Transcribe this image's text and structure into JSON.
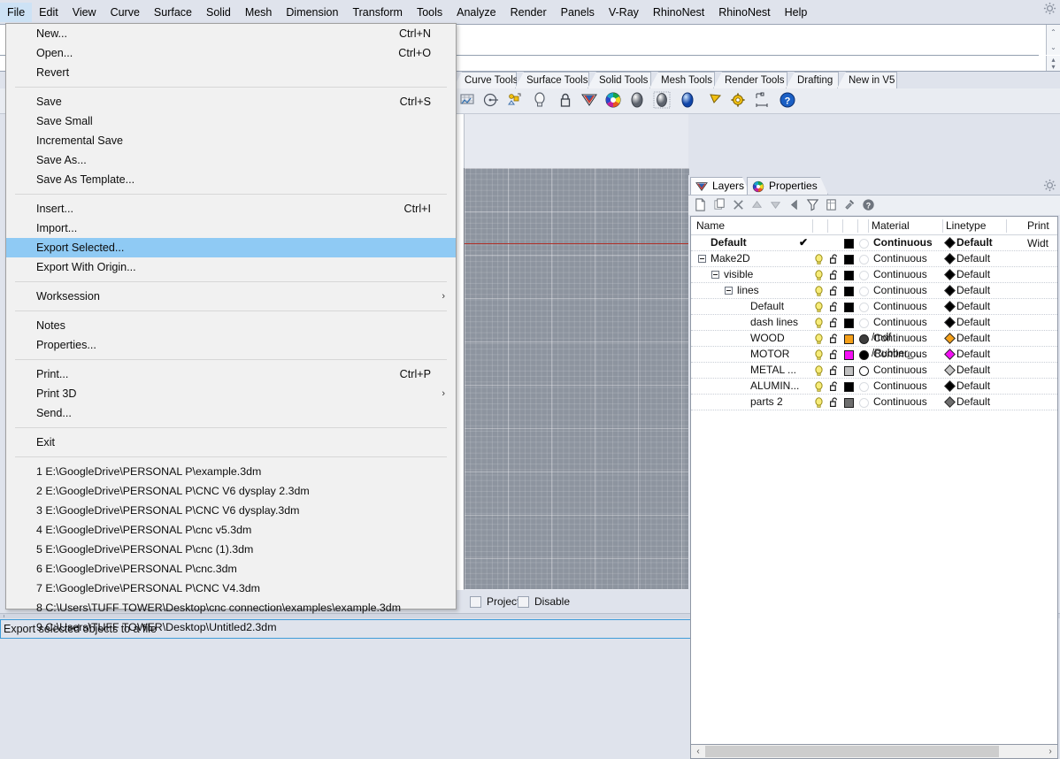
{
  "menubar": {
    "items": [
      {
        "label": "File",
        "active": true
      },
      {
        "label": "Edit",
        "active": false
      },
      {
        "label": "View",
        "active": false
      },
      {
        "label": "Curve",
        "active": false
      },
      {
        "label": "Surface",
        "active": false
      },
      {
        "label": "Solid",
        "active": false
      },
      {
        "label": "Mesh",
        "active": false
      },
      {
        "label": "Dimension",
        "active": false
      },
      {
        "label": "Transform",
        "active": false
      },
      {
        "label": "Tools",
        "active": false
      },
      {
        "label": "Analyze",
        "active": false
      },
      {
        "label": "Render",
        "active": false
      },
      {
        "label": "Panels",
        "active": false
      },
      {
        "label": "V-Ray",
        "active": false
      },
      {
        "label": "RhinoNest",
        "active": false
      },
      {
        "label": "RhinoNest",
        "active": false
      },
      {
        "label": "Help",
        "active": false
      }
    ]
  },
  "file_menu": {
    "groups": [
      {
        "items": [
          {
            "label": "New...",
            "shortcut": "Ctrl+N",
            "submenu": false,
            "highlight": false
          },
          {
            "label": "Open...",
            "shortcut": "Ctrl+O",
            "submenu": false,
            "highlight": false
          },
          {
            "label": "Revert",
            "shortcut": "",
            "submenu": false,
            "highlight": false
          }
        ]
      },
      {
        "items": [
          {
            "label": "Save",
            "shortcut": "Ctrl+S",
            "submenu": false,
            "highlight": false
          },
          {
            "label": "Save Small",
            "shortcut": "",
            "submenu": false,
            "highlight": false
          },
          {
            "label": "Incremental Save",
            "shortcut": "",
            "submenu": false,
            "highlight": false
          },
          {
            "label": "Save As...",
            "shortcut": "",
            "submenu": false,
            "highlight": false
          },
          {
            "label": "Save As Template...",
            "shortcut": "",
            "submenu": false,
            "highlight": false
          }
        ]
      },
      {
        "items": [
          {
            "label": "Insert...",
            "shortcut": "Ctrl+I",
            "submenu": false,
            "highlight": false
          },
          {
            "label": "Import...",
            "shortcut": "",
            "submenu": false,
            "highlight": false
          },
          {
            "label": "Export Selected...",
            "shortcut": "",
            "submenu": false,
            "highlight": true
          },
          {
            "label": "Export With Origin...",
            "shortcut": "",
            "submenu": false,
            "highlight": false
          }
        ]
      },
      {
        "items": [
          {
            "label": "Worksession",
            "shortcut": "",
            "submenu": true,
            "highlight": false
          }
        ]
      },
      {
        "items": [
          {
            "label": "Notes",
            "shortcut": "",
            "submenu": false,
            "highlight": false
          },
          {
            "label": "Properties...",
            "shortcut": "",
            "submenu": false,
            "highlight": false
          }
        ]
      },
      {
        "items": [
          {
            "label": "Print...",
            "shortcut": "Ctrl+P",
            "submenu": false,
            "highlight": false
          },
          {
            "label": "Print 3D",
            "shortcut": "",
            "submenu": true,
            "highlight": false
          },
          {
            "label": "Send...",
            "shortcut": "",
            "submenu": false,
            "highlight": false
          }
        ]
      },
      {
        "items": [
          {
            "label": "Exit",
            "shortcut": "",
            "submenu": false,
            "highlight": false
          }
        ]
      }
    ],
    "recent_files": [
      "1 E:\\GoogleDrive\\PERSONAL P\\example.3dm",
      "2 E:\\GoogleDrive\\PERSONAL P\\CNC V6 dysplay 2.3dm",
      "3 E:\\GoogleDrive\\PERSONAL P\\CNC V6 dysplay.3dm",
      "4 E:\\GoogleDrive\\PERSONAL P\\cnc v5.3dm",
      "5 E:\\GoogleDrive\\PERSONAL P\\cnc (1).3dm",
      "6 E:\\GoogleDrive\\PERSONAL P\\cnc.3dm",
      "7 E:\\GoogleDrive\\PERSONAL P\\CNC V4.3dm",
      "8 C:\\Users\\TUFF TOWER\\Desktop\\cnc connection\\examples\\example.3dm",
      "9 C:\\Users\\TUFF TOWER\\Desktop\\Untitled2.3dm"
    ]
  },
  "toolbar_tabs": {
    "items": [
      {
        "label": "Curve Tools"
      },
      {
        "label": "Surface Tools"
      },
      {
        "label": "Solid Tools"
      },
      {
        "label": "Mesh Tools"
      },
      {
        "label": "Render Tools"
      },
      {
        "label": "Drafting"
      },
      {
        "label": "New in V5"
      }
    ],
    "gear_icon": "gear-icon"
  },
  "icon_toolbar": {
    "icons": [
      "mesh-from-surface-icon",
      "render-preview-icon",
      "render-properties-icon",
      "spotlight-icon",
      "lock-icon",
      "rhino-render-icon",
      "color-wheel-icon",
      "material-sphere-grey-icon",
      "material-sphere-dotted-icon",
      "material-sphere-blue-icon",
      "directional-light-icon",
      "render-settings-gear-icon",
      "dimension-icon",
      "help-icon"
    ]
  },
  "viewport": {
    "grid_color": "#8d949f",
    "axis_color": "#b03028"
  },
  "options_bar": {
    "checkboxes": [
      {
        "label": "Project",
        "checked": false
      },
      {
        "label": "Disable",
        "checked": false
      }
    ]
  },
  "status_bar": {
    "text": "Export selected objects to a file"
  },
  "panel": {
    "tabs": [
      {
        "label": "Layers",
        "icon": "rhino-layers-icon",
        "selected": true
      },
      {
        "label": "Properties",
        "icon": "color-wheel-icon",
        "selected": false
      }
    ],
    "gear_icon": "gear-icon",
    "toolbar_icons": [
      "new-layer-icon",
      "copy-layer-icon",
      "delete-layer-icon",
      "move-up-icon",
      "move-down-icon",
      "move-left-icon",
      "filter-icon",
      "layer-properties-icon",
      "tools-hammer-icon",
      "help-icon"
    ],
    "columns": [
      "Name",
      "",
      "",
      "",
      "",
      "Material",
      "Linetype",
      "",
      "Print Widt"
    ],
    "rows": [
      {
        "name": "Default",
        "indent": 0,
        "expander": false,
        "current": true,
        "bold": true,
        "visible": false,
        "locked": false,
        "color": "#000000",
        "material": "",
        "material_name": "",
        "material_filled": false,
        "linetype": "Continuous",
        "print_width": "Default",
        "pw_color": "#000000"
      },
      {
        "name": "Make2D",
        "indent": 0,
        "expander": true,
        "current": false,
        "bold": false,
        "visible": true,
        "locked": false,
        "color": "#000000",
        "material": "",
        "material_name": "",
        "material_filled": false,
        "linetype": "Continuous",
        "print_width": "Default",
        "pw_color": "#000000"
      },
      {
        "name": "visible",
        "indent": 1,
        "expander": true,
        "current": false,
        "bold": false,
        "visible": true,
        "locked": false,
        "color": "#000000",
        "material": "",
        "material_name": "",
        "material_filled": false,
        "linetype": "Continuous",
        "print_width": "Default",
        "pw_color": "#000000"
      },
      {
        "name": "lines",
        "indent": 2,
        "expander": true,
        "current": false,
        "bold": false,
        "visible": true,
        "locked": false,
        "color": "#000000",
        "material": "",
        "material_name": "",
        "material_filled": false,
        "linetype": "Continuous",
        "print_width": "Default",
        "pw_color": "#000000"
      },
      {
        "name": "Default",
        "indent": 3,
        "expander": false,
        "current": false,
        "bold": false,
        "visible": true,
        "locked": false,
        "color": "#000000",
        "material": "",
        "material_name": "",
        "material_filled": false,
        "linetype": "Continuous",
        "print_width": "Default",
        "pw_color": "#000000"
      },
      {
        "name": "dash lines",
        "indent": 3,
        "expander": false,
        "current": false,
        "bold": false,
        "visible": true,
        "locked": false,
        "color": "#000000",
        "material": "",
        "material_name": "",
        "material_filled": false,
        "linetype": "Continuous",
        "print_width": "Default",
        "pw_color": "#000000"
      },
      {
        "name": "WOOD",
        "indent": 3,
        "expander": false,
        "current": false,
        "bold": false,
        "visible": true,
        "locked": false,
        "color": "#f5a019",
        "material": "#3d3d3d",
        "material_name": "/mdf",
        "material_filled": true,
        "linetype": "Continuous",
        "print_width": "Default",
        "pw_color": "#f5a019"
      },
      {
        "name": "MOTOR",
        "indent": 3,
        "expander": false,
        "current": false,
        "bold": false,
        "visible": true,
        "locked": false,
        "color": "#f50ef5",
        "material": "#000000",
        "material_name": "/Rubber_...",
        "material_filled": true,
        "linetype": "Continuous",
        "print_width": "Default",
        "pw_color": "#f50ef5"
      },
      {
        "name": "METAL ...",
        "indent": 3,
        "expander": false,
        "current": false,
        "bold": false,
        "visible": true,
        "locked": false,
        "color": "#c0c0c0",
        "material": "#ffffff",
        "material_name": "",
        "material_filled": true,
        "linetype": "Continuous",
        "print_width": "Default",
        "pw_color": "#c8c8c8"
      },
      {
        "name": "ALUMIN...",
        "indent": 3,
        "expander": false,
        "current": false,
        "bold": false,
        "visible": true,
        "locked": false,
        "color": "#000000",
        "material": "",
        "material_name": "",
        "material_filled": false,
        "linetype": "Continuous",
        "print_width": "Default",
        "pw_color": "#000000"
      },
      {
        "name": "parts 2",
        "indent": 3,
        "expander": false,
        "current": false,
        "bold": false,
        "visible": true,
        "locked": false,
        "color": "#6e6e6e",
        "material": "",
        "material_name": "",
        "material_filled": false,
        "linetype": "Continuous",
        "print_width": "Default",
        "pw_color": "#6e6e6e"
      }
    ],
    "hscroll": {
      "left_arrow": "‹",
      "right_arrow": "›"
    }
  }
}
